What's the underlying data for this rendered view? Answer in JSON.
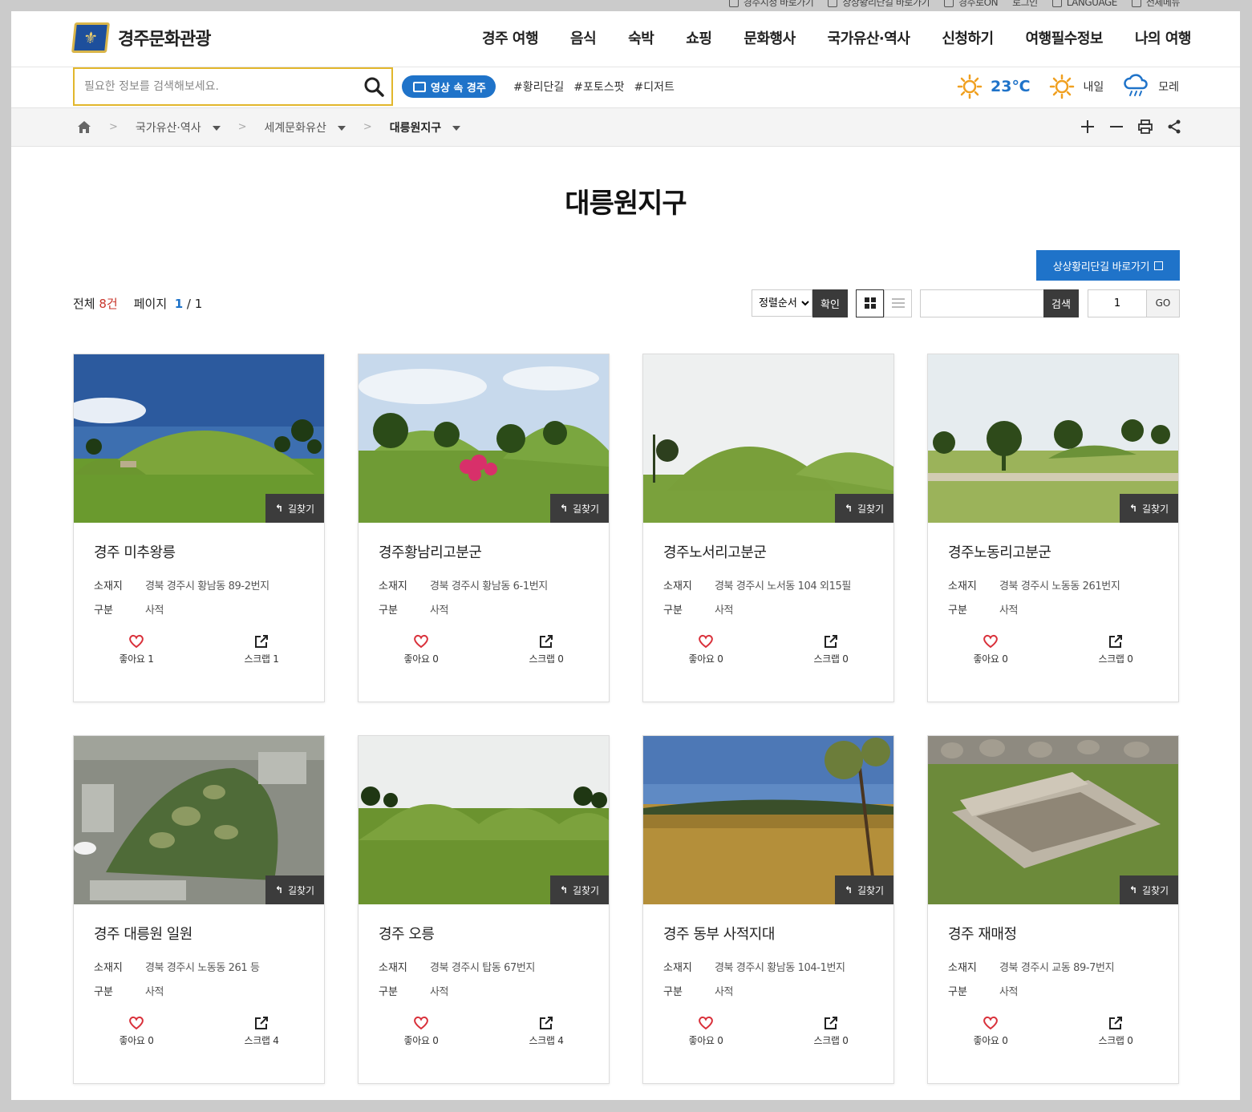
{
  "top_links": [
    {
      "label": "경주시청 바로가기",
      "icon": "home-icon"
    },
    {
      "label": "상상황리단길 바로가기",
      "icon": "home-icon"
    },
    {
      "label": "경주로ON",
      "icon": "app-icon"
    },
    {
      "label": "로그인",
      "icon": ""
    },
    {
      "label": "LANGUAGE",
      "icon": "globe-icon"
    },
    {
      "label": "전체메뉴",
      "icon": "grid-menu-icon"
    }
  ],
  "site": {
    "name": "경주문화관광"
  },
  "gnb": [
    "경주 여행",
    "음식",
    "숙박",
    "쇼핑",
    "문화행사",
    "국가유산·역사",
    "신청하기",
    "여행필수정보",
    "나의 여행"
  ],
  "search": {
    "placeholder": "필요한 정보를 검색해보세요."
  },
  "video_tag": "영상 속 경주",
  "hashtags": [
    "#황리단길",
    "#포토스팟",
    "#디저트"
  ],
  "weather": {
    "today": "23℃",
    "tomorrow": "내일",
    "day_after": "모레"
  },
  "breadcrumb": [
    "국가유산·역사",
    "세계문화유산",
    "대릉원지구"
  ],
  "page_title": "대릉원지구",
  "ext_button": "상상황리단길 바로가기",
  "list_info": {
    "total_label": "전체",
    "total": "8건",
    "page_label": "페이지",
    "page_current": "1",
    "page_total": "/ 1"
  },
  "controls": {
    "sort": "정렬순서",
    "confirm": "확인",
    "search": "검색",
    "page_value": "1",
    "go": "GO"
  },
  "labels": {
    "location": "소재지",
    "category": "구분",
    "navi": "길찾기"
  },
  "cards": [
    {
      "title": "경주 미추왕릉",
      "location": "경북 경주시 황남동 89-2번지",
      "category": "사적",
      "likes": "좋아요 1",
      "scraps": "스크랩 1",
      "scene": "mound-sky"
    },
    {
      "title": "경주황남리고분군",
      "location": "경북 경주시 황남동 6-1번지",
      "category": "사적",
      "likes": "좋아요 0",
      "scraps": "스크랩 0",
      "scene": "mound-flowers"
    },
    {
      "title": "경주노서리고분군",
      "location": "경북 경주시 노서동 104 외15필",
      "category": "사적",
      "likes": "좋아요 0",
      "scraps": "스크랩 0",
      "scene": "mound-pale"
    },
    {
      "title": "경주노동리고분군",
      "location": "경북 경주시 노동동 261번지",
      "category": "사적",
      "likes": "좋아요 0",
      "scraps": "스크랩 0",
      "scene": "park-trees"
    },
    {
      "title": "경주 대릉원 일원",
      "location": "경북 경주시 노동동 261 등",
      "category": "사적",
      "likes": "좋아요 0",
      "scraps": "스크랩 4",
      "scene": "aerial"
    },
    {
      "title": "경주 오릉",
      "location": "경북 경주시 탑동 67번지",
      "category": "사적",
      "likes": "좋아요 0",
      "scraps": "스크랩 4",
      "scene": "mound-row"
    },
    {
      "title": "경주 동부 사적지대",
      "location": "경북 경주시 황남동 104-1번지",
      "category": "사적",
      "likes": "좋아요 0",
      "scraps": "스크랩 0",
      "scene": "field"
    },
    {
      "title": "경주 재매정",
      "location": "경북 경주시 교동 89-7번지",
      "category": "사적",
      "likes": "좋아요 0",
      "scraps": "스크랩 0",
      "scene": "stone-well"
    }
  ]
}
